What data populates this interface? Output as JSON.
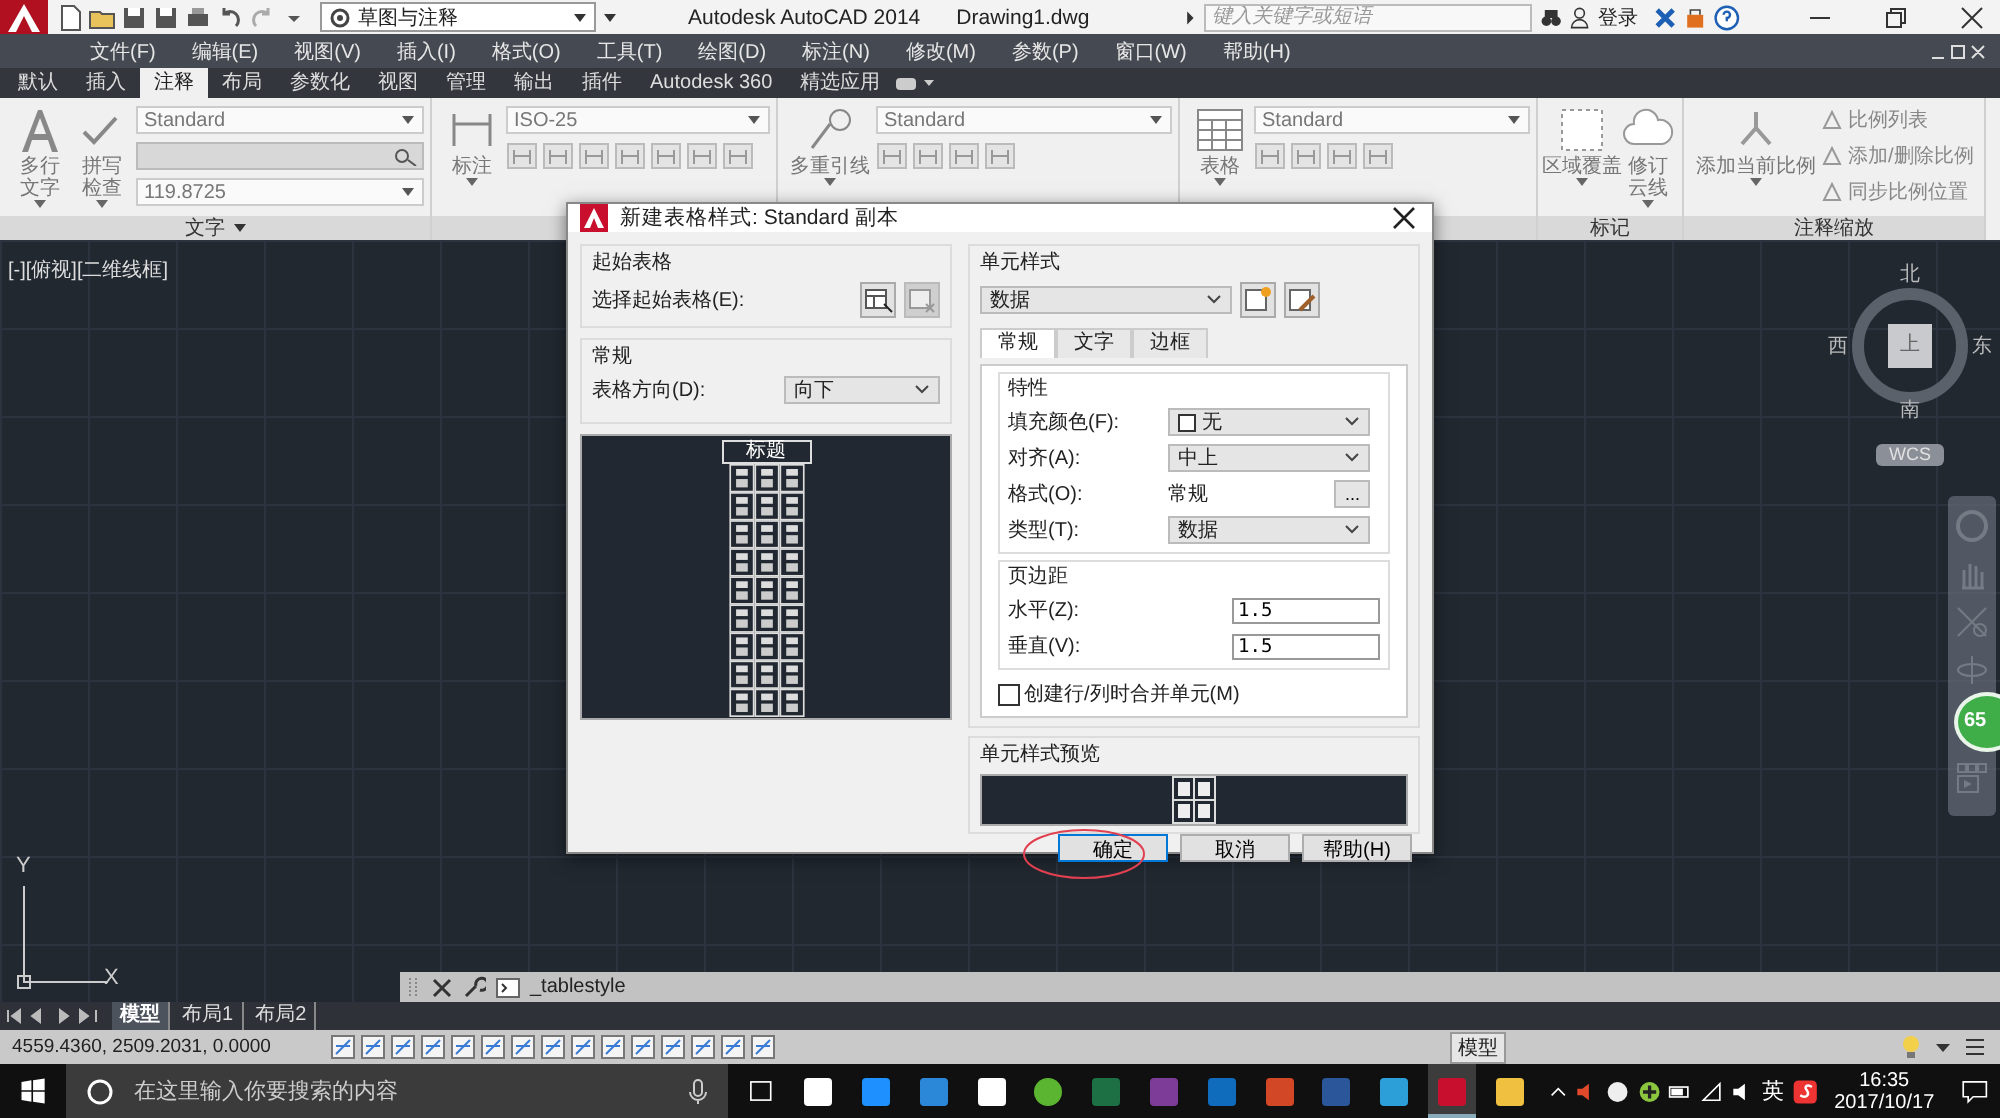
{
  "title_bar": {
    "workspace": "草图与注释",
    "app_name": "Autodesk AutoCAD 2014",
    "file_name": "Drawing1.dwg",
    "search_placeholder": "键入关键字或短语",
    "login": "登录"
  },
  "menu": [
    "文件(F)",
    "编辑(E)",
    "视图(V)",
    "插入(I)",
    "格式(O)",
    "工具(T)",
    "绘图(D)",
    "标注(N)",
    "修改(M)",
    "参数(P)",
    "窗口(W)",
    "帮助(H)"
  ],
  "ribbon_tabs": [
    {
      "label": "默认",
      "selected": false
    },
    {
      "label": "插入",
      "selected": false
    },
    {
      "label": "注释",
      "selected": true
    },
    {
      "label": "布局",
      "selected": false
    },
    {
      "label": "参数化",
      "selected": false
    },
    {
      "label": "视图",
      "selected": false
    },
    {
      "label": "管理",
      "selected": false
    },
    {
      "label": "输出",
      "selected": false
    },
    {
      "label": "插件",
      "selected": false
    },
    {
      "label": "Autodesk 360",
      "selected": false
    },
    {
      "label": "精选应用",
      "selected": false
    }
  ],
  "ribbon_panels": [
    {
      "kind": "text",
      "title": "文字",
      "big_buttons": [
        {
          "lines": [
            "多行",
            "文字"
          ]
        },
        {
          "lines": [
            "拼写",
            "检查"
          ]
        }
      ],
      "controls": [
        {
          "kind": "dropdown",
          "value": "Standard"
        },
        {
          "kind": "field"
        },
        {
          "kind": "dropdown",
          "value": "119.8725"
        }
      ]
    },
    {
      "kind": "dimension",
      "big_buttons": [
        {
          "lines": [
            "标注"
          ]
        }
      ],
      "controls": [
        {
          "kind": "dropdown",
          "value": "ISO-25"
        },
        {
          "kind": "tools"
        }
      ]
    },
    {
      "kind": "leader",
      "big_buttons": [
        {
          "lines": [
            "多重引线"
          ]
        }
      ],
      "controls": [
        {
          "kind": "dropdown",
          "value": "Standard"
        },
        {
          "kind": "tools"
        }
      ]
    },
    {
      "kind": "table",
      "big_buttons": [
        {
          "lines": [
            "表格"
          ]
        }
      ],
      "controls": [
        {
          "kind": "dropdown",
          "value": "Standard"
        },
        {
          "kind": "tools"
        }
      ]
    },
    {
      "kind": "markup",
      "title": "标记",
      "big_buttons": [
        {
          "lines": [
            "区域覆盖"
          ]
        },
        {
          "lines": [
            "修订",
            "云线"
          ]
        }
      ]
    },
    {
      "kind": "scale",
      "title": "注释缩放",
      "big_buttons": [
        {
          "lines": [
            "添加当前比例"
          ]
        }
      ],
      "controls": [
        {
          "kind": "link",
          "label": "比例列表"
        },
        {
          "kind": "link",
          "label": "添加/删除比例"
        },
        {
          "kind": "link",
          "label": "同步比例位置"
        }
      ]
    }
  ],
  "canvas": {
    "viewport_label": "[-][俯视][二维线框]",
    "viewcube": {
      "north": "北",
      "south": "南",
      "west": "西",
      "east": "东",
      "face": "上",
      "ucs": "WCS"
    },
    "badge": "65",
    "axis_x": "X",
    "axis_y": "Y",
    "command": "_tablestyle"
  },
  "layout_tabs": [
    {
      "label": "模型",
      "selected": true
    },
    {
      "label": "布局1",
      "selected": false
    },
    {
      "label": "布局2",
      "selected": false
    }
  ],
  "status_bar": {
    "coordinates": "4559.4360, 2509.2031, 0.0000",
    "mode": "模型"
  },
  "dialog": {
    "title": "新建表格样式: Standard 副本",
    "start_group": "起始表格",
    "start_label": "选择起始表格(E):",
    "general_group": "常规",
    "direction_label": "表格方向(D):",
    "direction_value": "向下",
    "preview_title": "标题",
    "cell_style_group": "单元样式",
    "cell_style_value": "数据",
    "tabs": [
      {
        "label": "常规",
        "selected": true
      },
      {
        "label": "文字",
        "selected": false
      },
      {
        "label": "边框",
        "selected": false
      }
    ],
    "props_group": "特性",
    "props": [
      {
        "kind": "color",
        "label": "填充颜色(F):",
        "value": "无"
      },
      {
        "kind": "select",
        "label": "对齐(A):",
        "value": "中上"
      },
      {
        "kind": "more",
        "label": "格式(O):",
        "value": "常规",
        "button": "..."
      },
      {
        "kind": "select",
        "label": "类型(T):",
        "value": "数据"
      }
    ],
    "margins_group": "页边距",
    "margins": [
      {
        "label": "水平(Z):",
        "value": "1.5"
      },
      {
        "label": "垂直(V):",
        "value": "1.5"
      }
    ],
    "merge": {
      "label": "创建行/列时合并单元(M)",
      "checked": false
    },
    "cell_preview_group": "单元样式预览",
    "buttons": [
      {
        "label": "确定",
        "default": true,
        "circled": true
      },
      {
        "label": "取消",
        "default": false,
        "circled": false
      },
      {
        "label": "帮助(H)",
        "default": false,
        "circled": false
      }
    ]
  },
  "taskbar": {
    "search_placeholder": "在这里输入你要搜索的内容",
    "ime": "英",
    "time": "16:35",
    "date": "2017/10/17"
  }
}
